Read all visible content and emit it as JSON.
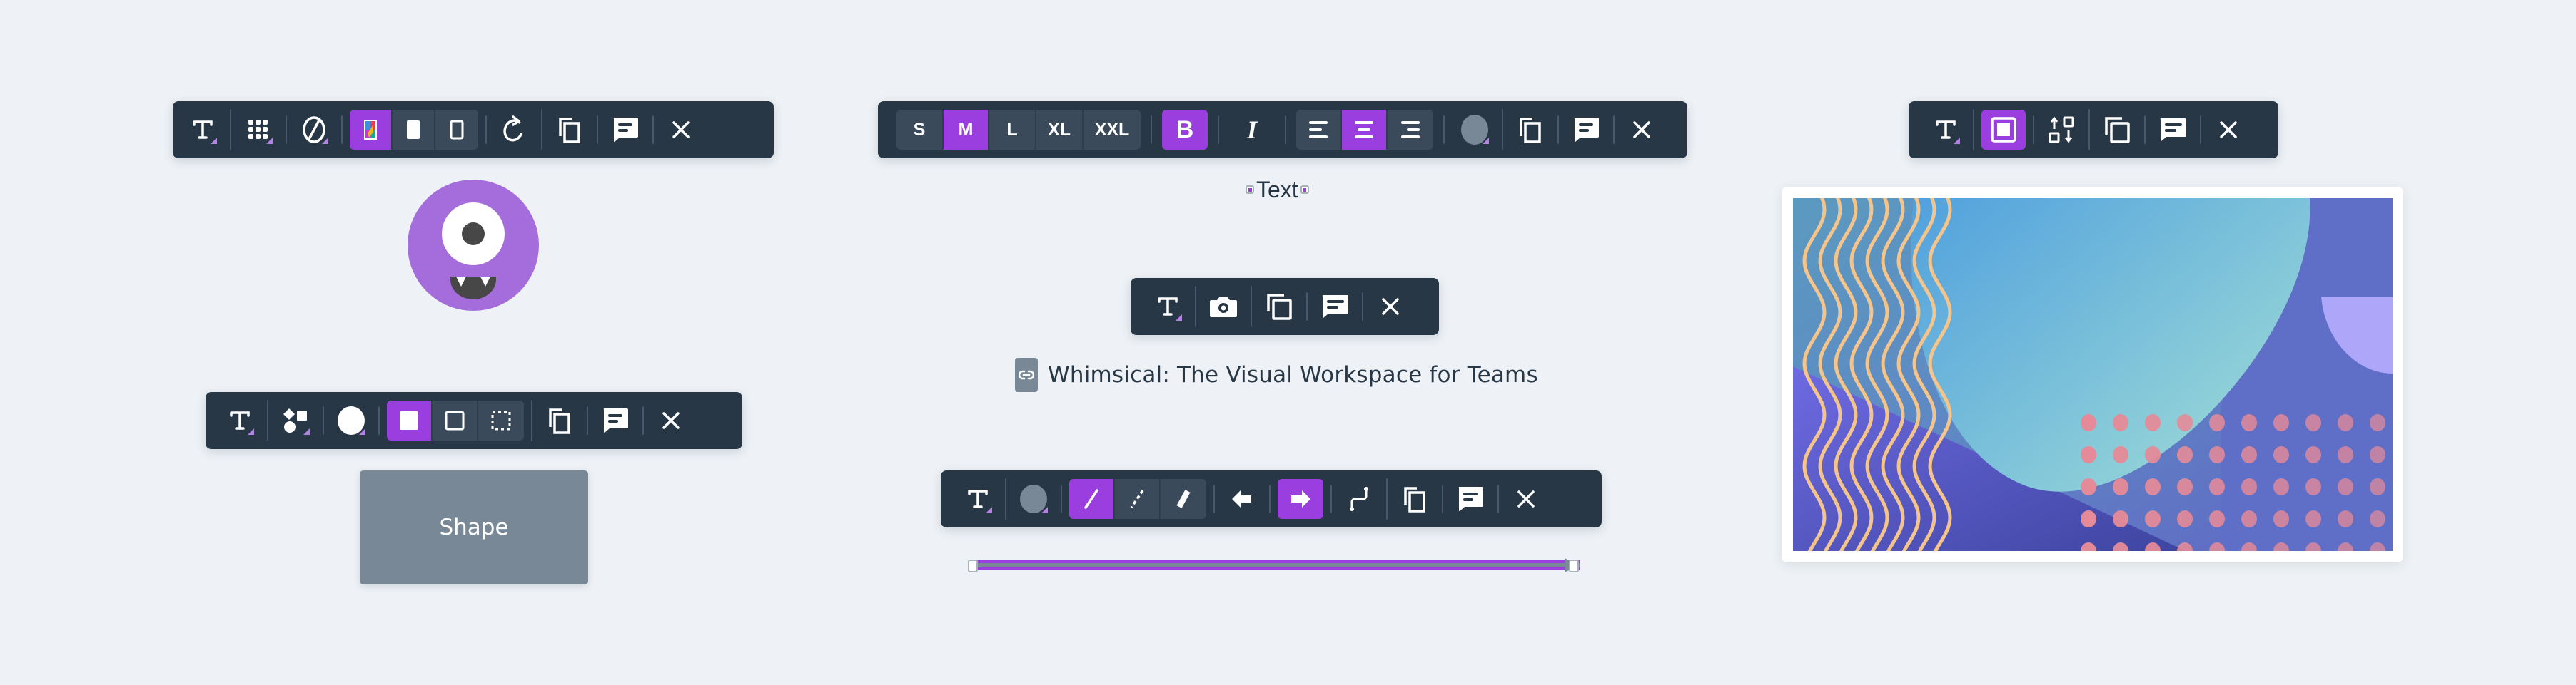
{
  "colors": {
    "background": "#eef2f6",
    "toolbar": "#283746",
    "accent": "#9b3ee0",
    "segment": "#3a4a5a",
    "shape_fill": "#788897",
    "text_dark": "#283746"
  },
  "toolbars": {
    "avatar": {
      "buttons": [
        {
          "icon": "text-style-icon",
          "label": "Text style",
          "active": false
        },
        {
          "icon": "grid-icon",
          "label": "Emoji / icon set",
          "active": false
        },
        {
          "icon": "no-fill-icon",
          "label": "Background color",
          "active": false
        },
        {
          "icon": "color-style-icon",
          "label": "Colored style",
          "active": true
        },
        {
          "icon": "solid-style-icon",
          "label": "Solid style",
          "active": false
        },
        {
          "icon": "outline-style-icon",
          "label": "Outline style",
          "active": false
        },
        {
          "icon": "rotate-icon",
          "label": "Rotate",
          "active": false
        },
        {
          "icon": "duplicate-icon",
          "label": "Duplicate",
          "active": false
        },
        {
          "icon": "comment-icon",
          "label": "Comment",
          "active": false
        },
        {
          "icon": "close-icon",
          "label": "Delete",
          "active": false
        }
      ]
    },
    "text": {
      "sizes": [
        {
          "label": "S",
          "active": false
        },
        {
          "label": "M",
          "active": true
        },
        {
          "label": "L",
          "active": false
        },
        {
          "label": "XL",
          "active": false
        },
        {
          "label": "XXL",
          "active": false
        }
      ],
      "bold": {
        "label": "B",
        "active": true
      },
      "italic": {
        "label": "I",
        "active": false
      },
      "align": [
        {
          "icon": "align-left-icon",
          "active": false
        },
        {
          "icon": "align-center-icon",
          "active": true
        },
        {
          "icon": "align-right-icon",
          "active": false
        }
      ],
      "color": "#788897"
    },
    "image": {
      "buttons": [
        {
          "icon": "text-style-icon",
          "active": false
        },
        {
          "icon": "frame-border-icon",
          "active": true
        },
        {
          "icon": "swap-order-icon",
          "active": false
        },
        {
          "icon": "duplicate-icon",
          "active": false
        },
        {
          "icon": "comment-icon",
          "active": false
        },
        {
          "icon": "close-icon",
          "active": false
        }
      ]
    },
    "link": {
      "buttons": [
        {
          "icon": "text-style-icon",
          "active": false
        },
        {
          "icon": "camera-icon",
          "active": false
        },
        {
          "icon": "duplicate-icon",
          "active": false
        },
        {
          "icon": "comment-icon",
          "active": false
        },
        {
          "icon": "close-icon",
          "active": false
        }
      ]
    },
    "shape": {
      "fill_color": "#ffffff",
      "styles": [
        {
          "icon": "filled-border-icon",
          "active": true
        },
        {
          "icon": "outline-border-icon",
          "active": false
        },
        {
          "icon": "dashed-border-icon",
          "active": false
        }
      ]
    },
    "line": {
      "color": "#788897",
      "styles": [
        {
          "icon": "solid-line-icon",
          "active": true
        },
        {
          "icon": "dashed-line-icon",
          "active": false
        },
        {
          "icon": "thick-line-icon",
          "active": false
        }
      ],
      "start_arrow_active": false,
      "end_arrow_active": true
    }
  },
  "canvas": {
    "text_element": "Text",
    "link_title": "Whimsical: The Visual Workspace for Teams",
    "shape_label": "Shape",
    "avatar_color": "#a56ddb",
    "line_color": "#9b3ee0"
  }
}
